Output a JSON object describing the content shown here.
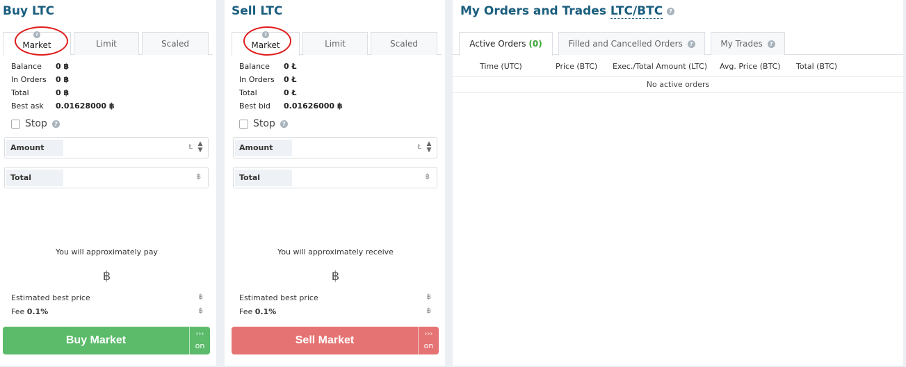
{
  "buy": {
    "title": "Buy LTC",
    "tabs": [
      "Market",
      "Limit",
      "Scaled"
    ],
    "rows": [
      {
        "label": "Balance",
        "value": "0 ฿"
      },
      {
        "label": "In Orders",
        "value": "0 ฿"
      },
      {
        "label": "Total",
        "value": "0 ฿"
      },
      {
        "label": "Best ask",
        "value": "0.01628000 ฿"
      }
    ],
    "stop_label": "Stop",
    "amount_label": "Amount",
    "amount_unit": "Ł",
    "total_label": "Total",
    "total_unit": "฿",
    "approx_text": "You will approximately pay",
    "big_coin": "฿",
    "est_price_label": "Estimated best price",
    "est_price_unit": "฿",
    "fee_label": "Fee",
    "fee_value": "0.1%",
    "fee_unit": "฿",
    "button_label": "Buy Market",
    "button_side": "on"
  },
  "sell": {
    "title": "Sell LTC",
    "tabs": [
      "Market",
      "Limit",
      "Scaled"
    ],
    "rows": [
      {
        "label": "Balance",
        "value": "0 Ł"
      },
      {
        "label": "In Orders",
        "value": "0 Ł"
      },
      {
        "label": "Total",
        "value": "0 Ł"
      },
      {
        "label": "Best bid",
        "value": "0.01626000 ฿"
      }
    ],
    "stop_label": "Stop",
    "amount_label": "Amount",
    "amount_unit": "Ł",
    "total_label": "Total",
    "total_unit": "฿",
    "approx_text": "You will approximately receive",
    "big_coin": "฿",
    "est_price_label": "Estimated best price",
    "est_price_unit": "฿",
    "fee_label": "Fee",
    "fee_value": "0.1%",
    "fee_unit": "฿",
    "button_label": "Sell Market",
    "button_side": "on"
  },
  "orders": {
    "title": "My Orders and Trades",
    "pair": "LTC/BTC",
    "tabs": [
      {
        "label": "Active Orders",
        "count": "(0)"
      },
      {
        "label": "Filled and Cancelled Orders"
      },
      {
        "label": "My Trades"
      }
    ],
    "columns": [
      "Time (UTC)",
      "Price (BTC)",
      "Exec./Total Amount (LTC)",
      "Avg. Price (BTC)",
      "Total (BTC)"
    ],
    "empty_text": "No active orders"
  },
  "colors": {
    "title": "#1b5e7e",
    "buy_button": "#5bbb6a",
    "sell_button": "#e57373",
    "annotation_circle": "#e01b1b",
    "count_green": "#3aa335"
  },
  "icons": {
    "help": "?",
    "button_arrows": "›››"
  }
}
